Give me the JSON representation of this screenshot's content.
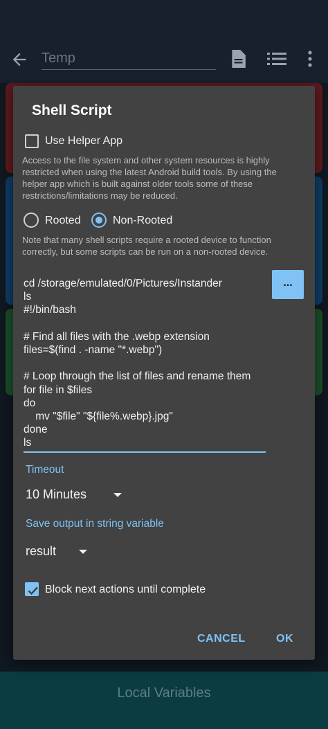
{
  "app": {
    "title": "Temp",
    "bottom_tab": "Local Variables"
  },
  "dialog": {
    "title": "Shell Script",
    "use_helper_app": {
      "label": "Use Helper App",
      "checked": false
    },
    "helper_description": "Access to the file system and other system resources is highly restricted when using the latest Android build tools. By using the helper app which is built against older tools some of these restrictions/limitations may be reduced.",
    "root_options": [
      {
        "label": "Rooted",
        "selected": false
      },
      {
        "label": "Non-Rooted",
        "selected": true
      }
    ],
    "root_description": "Note that many shell scripts require a rooted device to function correctly, but some scripts can be run on a non-rooted device.",
    "script": "cd /storage/emulated/0/Pictures/Instander\nls\n#!/bin/bash\n\n# Find all files with the .webp extension\nfiles=$(find . -name \"*.webp\")\n\n# Loop through the list of files and rename them\nfor file in $files\ndo\n    mv \"$file\" \"${file%.webp}.jpg\"\ndone\nls",
    "dots_button": "...",
    "timeout_label": "Timeout",
    "timeout_value": "10 Minutes",
    "save_output_label": "Save output in string variable",
    "save_output_value": "result",
    "block_actions": {
      "label": "Block next actions until complete",
      "checked": true
    },
    "cancel": "CANCEL",
    "ok": "OK"
  },
  "colors": {
    "accent": "#80c2f4",
    "dialog_bg": "#424242",
    "app_bg": "#17212d"
  }
}
